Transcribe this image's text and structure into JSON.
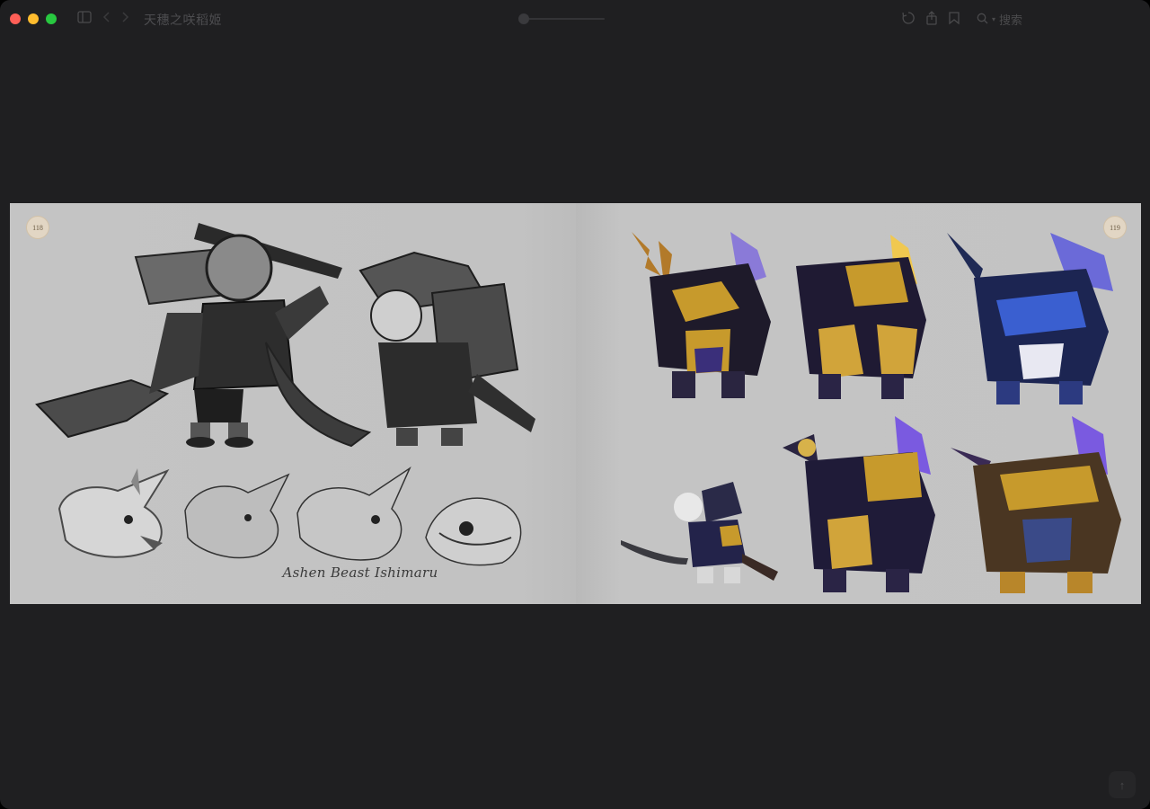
{
  "window": {
    "title": "天穗之咲稻姬"
  },
  "toolbar": {
    "search_label": "搜索"
  },
  "spread": {
    "left_page_number": "118",
    "right_page_number": "119",
    "caption": "Ashen Beast Ishimaru"
  },
  "colors": {
    "window_bg": "#1f1f21",
    "page_bg": "#c3c3c3",
    "accent_gold": "#c79a2c",
    "accent_purple": "#6a4fc8",
    "accent_blue": "#3a5fd0"
  },
  "icons": {
    "sidebar": "sidebar-icon",
    "back": "chevron-left-icon",
    "forward": "chevron-right-icon",
    "rotate": "rotate-icon",
    "share": "share-icon",
    "bookmark": "bookmark-icon",
    "search": "search-icon",
    "scroll_up": "arrow-up-icon"
  }
}
